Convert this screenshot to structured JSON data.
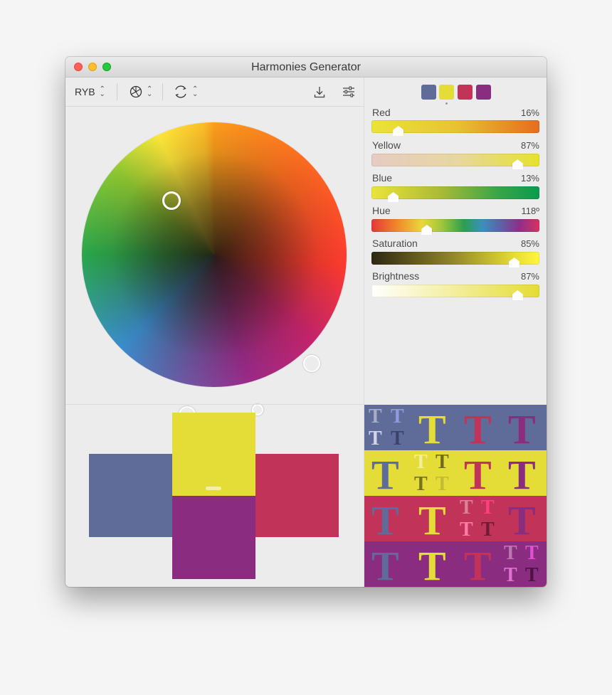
{
  "window": {
    "title": "Harmonies Generator"
  },
  "toolbar": {
    "mode_label": "RYB",
    "harmony_icon": "color-wheel-icon",
    "rotation_icon": "rotate-icon",
    "export_icon": "download-icon",
    "settings_icon": "sliders-icon"
  },
  "swatches": [
    {
      "name": "blue-gray",
      "color": "#5f6b98"
    },
    {
      "name": "yellow",
      "color": "#e4dd38"
    },
    {
      "name": "crimson",
      "color": "#c13359"
    },
    {
      "name": "purple",
      "color": "#8a2c7f"
    }
  ],
  "selected_swatch": 1,
  "sliders": [
    {
      "label": "Red",
      "value": "16%",
      "level": 0.16
    },
    {
      "label": "Yellow",
      "value": "87%",
      "level": 0.87
    },
    {
      "label": "Blue",
      "value": "13%",
      "level": 0.13
    },
    {
      "label": "Hue",
      "value": "118º",
      "level": 0.33
    },
    {
      "label": "Saturation",
      "value": "85%",
      "level": 0.85
    },
    {
      "label": "Brightness",
      "value": "87%",
      "level": 0.87
    }
  ],
  "preview_glyph": "T",
  "colors": {
    "bluegray": "#5f6b98",
    "yellow": "#e4dd38",
    "crimson": "#c13359",
    "purple": "#8a2c7f"
  }
}
